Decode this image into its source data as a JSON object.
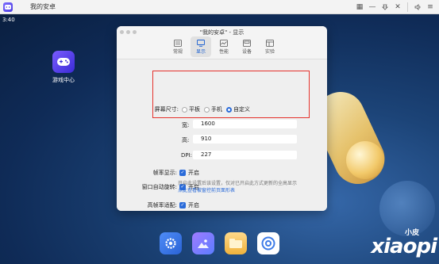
{
  "host": {
    "title": "我的安卓",
    "toolbar_icons": [
      "grid-icon",
      "minimize-icon",
      "pin-icon",
      "close-icon",
      "volume-icon",
      "menu-icon"
    ]
  },
  "statusbar": {
    "time": "3:40"
  },
  "desktop": {
    "apps": [
      {
        "label": "游戏中心",
        "icon": "gamepad-icon"
      }
    ],
    "dock": [
      "settings-icon",
      "gallery-icon",
      "files-icon",
      "browser-icon"
    ]
  },
  "settings": {
    "title": "\"我的安卓\" - 显示",
    "tabs": [
      {
        "label": "常规",
        "icon": "general-icon",
        "active": false
      },
      {
        "label": "显示",
        "icon": "display-icon",
        "active": true
      },
      {
        "label": "性能",
        "icon": "performance-icon",
        "active": false
      },
      {
        "label": "设备",
        "icon": "device-icon",
        "active": false
      },
      {
        "label": "实验",
        "icon": "lab-icon",
        "active": false
      }
    ],
    "screen_size_label": "屏幕尺寸:",
    "options": [
      {
        "label": "平板",
        "checked": false
      },
      {
        "label": "手机",
        "checked": false
      },
      {
        "label": "自定义",
        "checked": true
      }
    ],
    "width_label": "宽:",
    "width_value": "1600",
    "height_label": "高:",
    "height_value": "910",
    "dpi_label": "DPI:",
    "dpi_value": "227",
    "fps_label": "帧率显示:",
    "fps_value": "开启",
    "rotate_label": "窗口自动旋转:",
    "rotate_value": "开启",
    "adapt_label": "高帧率适配:",
    "adapt_value": "开启",
    "hint_text": "开启此设置后该设置，仅对已开启此方式更新的全高显示",
    "hint_link": "点此查看被窗控前页面形表",
    "accent_color": "#2a6bd9",
    "highlight_color": "#e5312b"
  },
  "watermark": {
    "small": "小皮",
    "big": "xiaopi"
  }
}
